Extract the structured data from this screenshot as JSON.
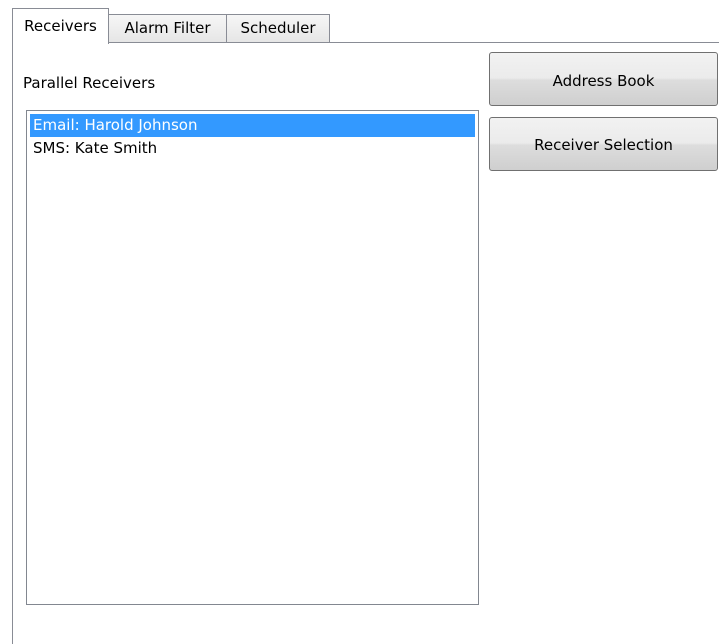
{
  "tabs": [
    {
      "label": "Receivers",
      "active": true
    },
    {
      "label": "Alarm Filter",
      "active": false
    },
    {
      "label": "Scheduler",
      "active": false
    }
  ],
  "receivers_panel": {
    "list_label": "Parallel Receivers",
    "items": [
      {
        "label": "Email: Harold Johnson",
        "selected": true
      },
      {
        "label": "SMS: Kate Smith",
        "selected": false
      }
    ],
    "address_book_label": "Address Book",
    "receiver_selection_label": "Receiver Selection"
  },
  "colors": {
    "selection": "#3399ff",
    "border": "#898c95"
  }
}
